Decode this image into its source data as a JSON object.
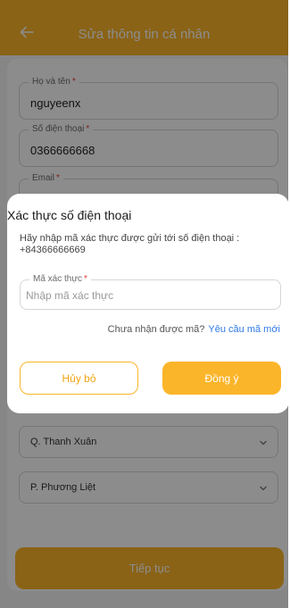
{
  "header": {
    "title": "Sửa thông tin cá nhân",
    "back_icon": "arrow-left-icon"
  },
  "form": {
    "full_name": {
      "label": "Họ và tên",
      "required_mark": "*",
      "value": "nguyeenx"
    },
    "phone": {
      "label": "Số điện thoại",
      "required_mark": "*",
      "value": "0366666668"
    },
    "email": {
      "label": "Email",
      "required_mark": "*"
    },
    "district": {
      "value": "Q. Thanh Xuân",
      "icon": "chevron-down-icon"
    },
    "ward": {
      "value": "P. Phương Liệt",
      "icon": "chevron-down-icon"
    },
    "continue_label": "Tiếp tục"
  },
  "modal": {
    "title": "Xác thực số điện thoại",
    "description": "Hãy nhập mã xác thực được gửi tới số điện thoại : +84366666669",
    "code_label": "Mã xác thực",
    "code_required_mark": "*",
    "code_placeholder": "Nhập mã xác thực",
    "resend_question": "Chưa nhận được mã?",
    "resend_link": "Yêu cầu mã mới",
    "cancel_label": "Hủy bỏ",
    "confirm_label": "Đồng ý"
  },
  "colors": {
    "accent": "#fbb52a",
    "link": "#2f7ae5",
    "required": "#e53935"
  }
}
